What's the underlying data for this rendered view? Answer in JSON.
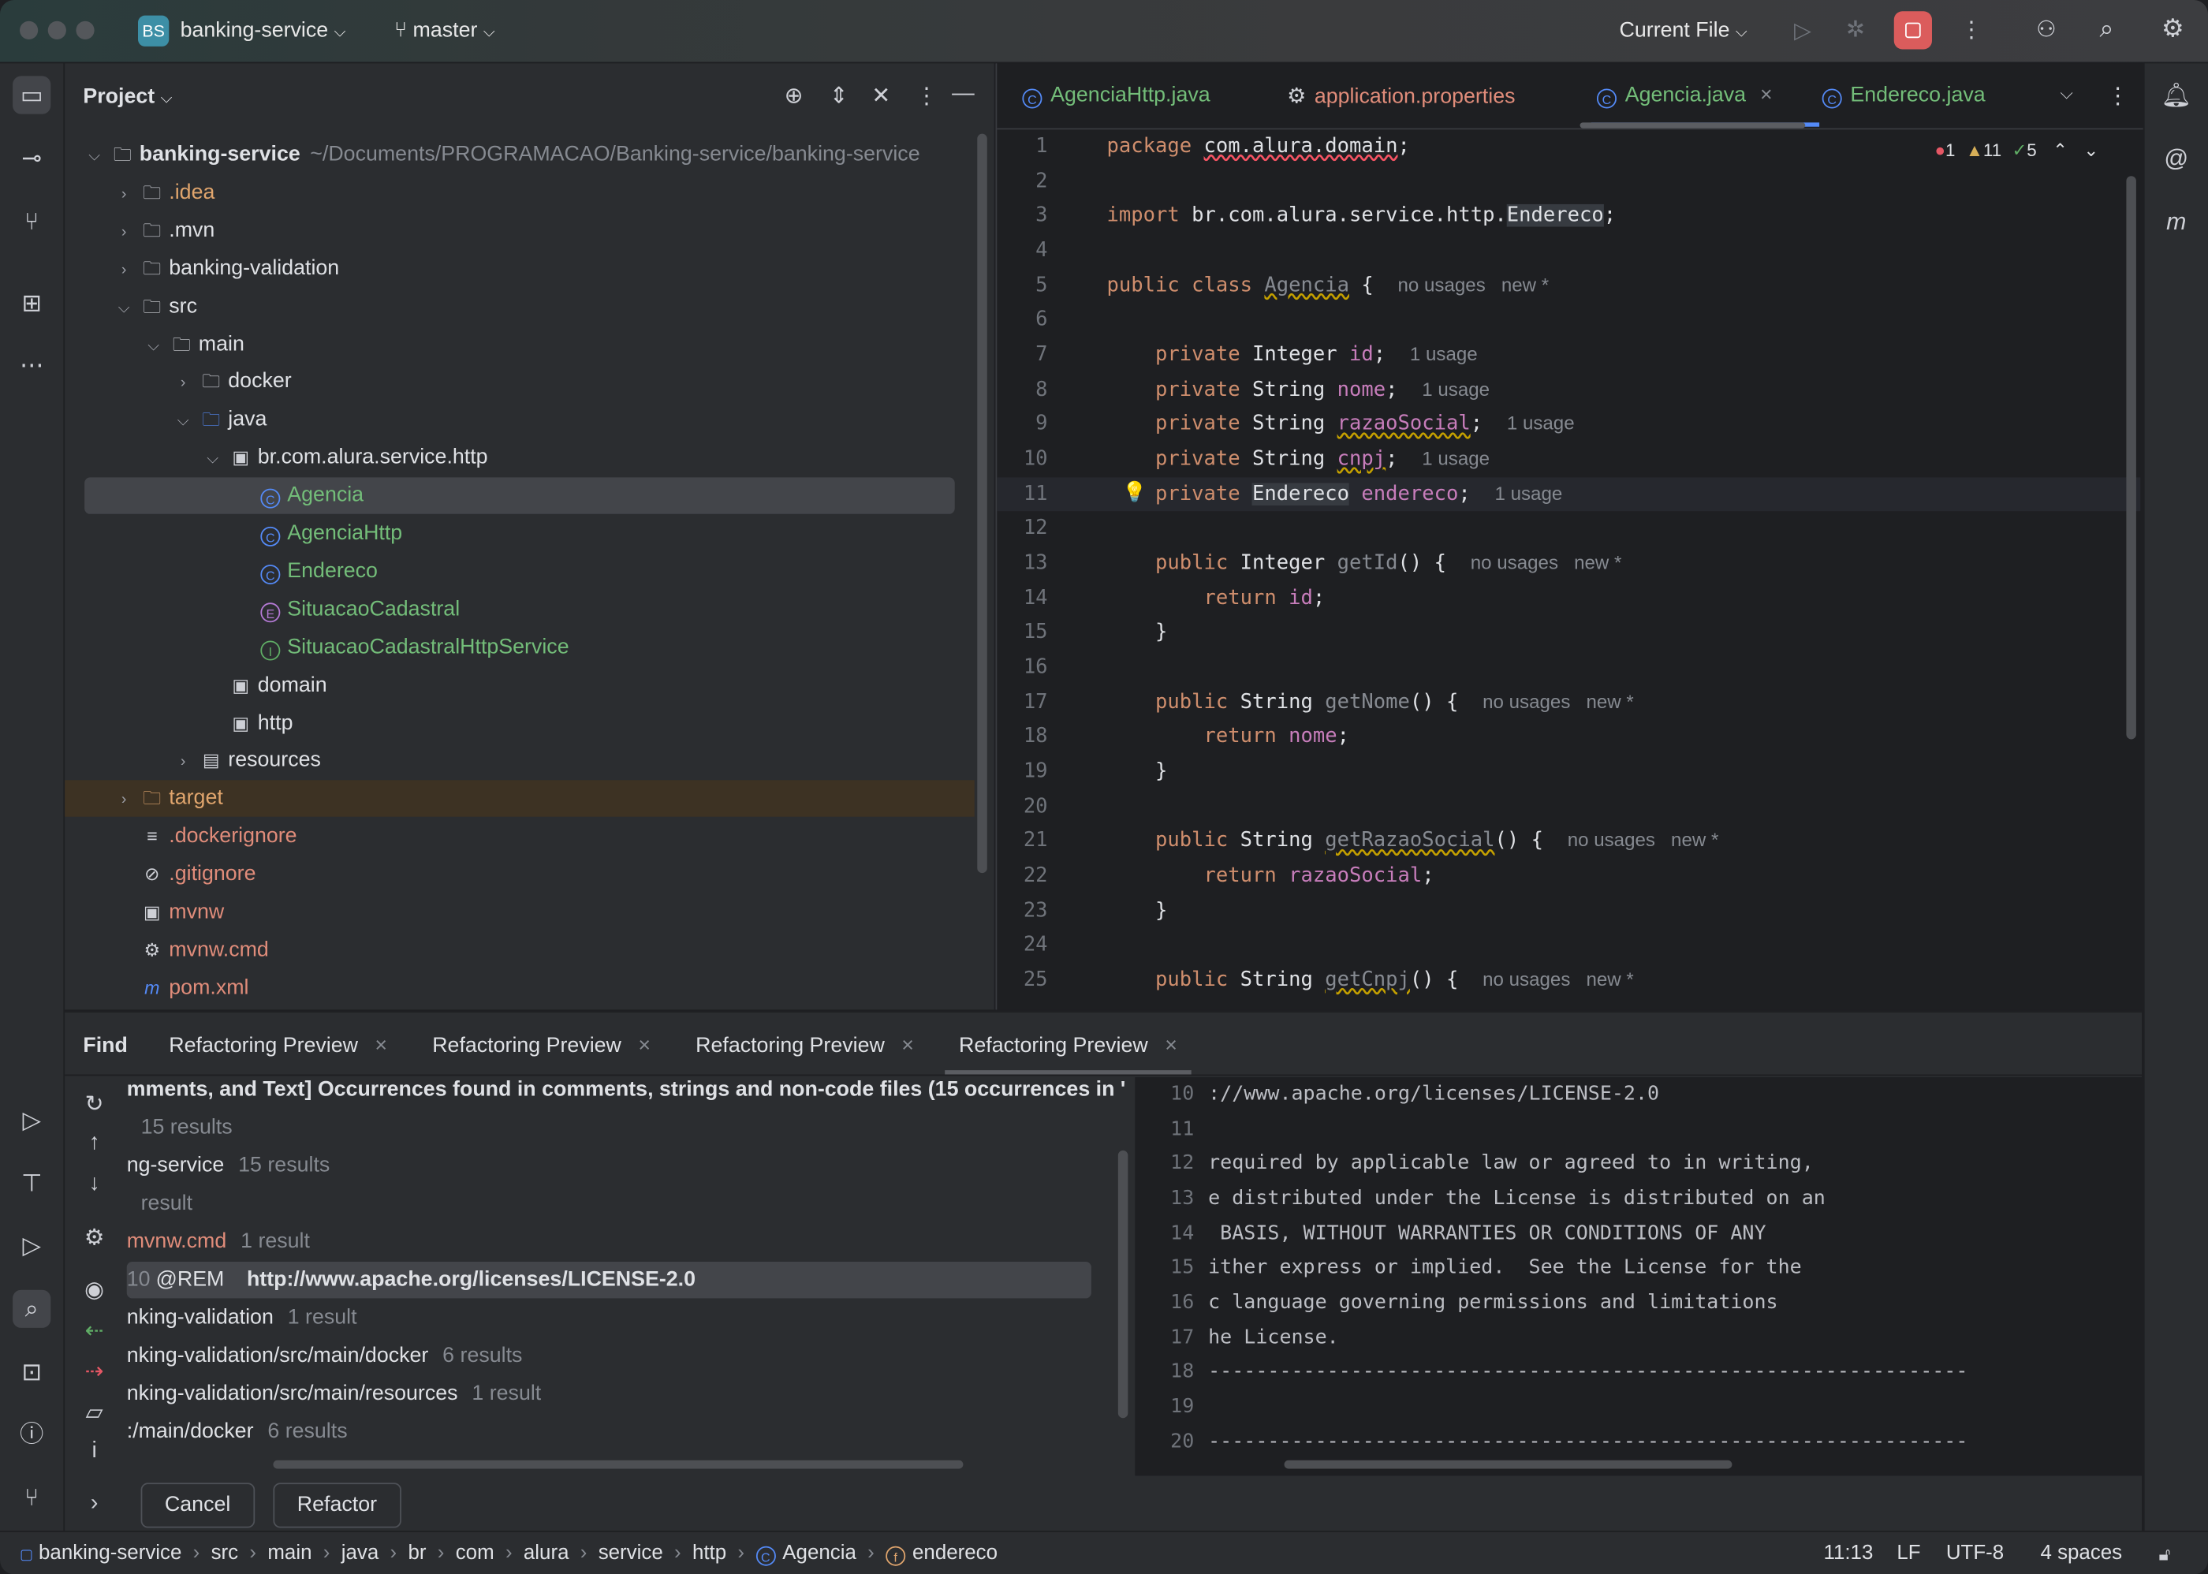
{
  "titlebar": {
    "project_badge": "BS",
    "project": "banking-service",
    "branch": "master",
    "run_config": "Current File",
    "icons": [
      "run-icon",
      "debug-icon",
      "stop-icon",
      "more-icon",
      "add-user-icon",
      "search-icon",
      "settings-icon"
    ]
  },
  "project_panel": {
    "title": "Project",
    "tree": [
      {
        "level": 0,
        "arrow": "down",
        "icon": "module",
        "label": "banking-service",
        "path": "~/Documents/PROGRAMACAO/Banking-service/banking-service",
        "bold": true
      },
      {
        "level": 1,
        "arrow": "right",
        "icon": "folder",
        "label": ".idea",
        "color": "#e0a56d"
      },
      {
        "level": 1,
        "arrow": "right",
        "icon": "folder",
        "label": ".mvn"
      },
      {
        "level": 1,
        "arrow": "right",
        "icon": "folder",
        "label": "banking-validation"
      },
      {
        "level": 1,
        "arrow": "down",
        "icon": "folder",
        "label": "src"
      },
      {
        "level": 2,
        "arrow": "down",
        "icon": "folder",
        "label": "main"
      },
      {
        "level": 3,
        "arrow": "right",
        "icon": "folder",
        "label": "docker"
      },
      {
        "level": 3,
        "arrow": "down",
        "icon": "folder-blue",
        "label": "java"
      },
      {
        "level": 4,
        "arrow": "down",
        "icon": "package",
        "label": "br.com.alura.service.http"
      },
      {
        "level": 5,
        "icon": "class",
        "label": "Agencia",
        "color": "#73bd79",
        "selected": true
      },
      {
        "level": 5,
        "icon": "class",
        "label": "AgenciaHttp",
        "color": "#73bd79"
      },
      {
        "level": 5,
        "icon": "class",
        "label": "Endereco",
        "color": "#73bd79"
      },
      {
        "level": 5,
        "icon": "enum",
        "label": "SituacaoCadastral",
        "color": "#73bd79"
      },
      {
        "level": 5,
        "icon": "interface",
        "label": "SituacaoCadastralHttpService",
        "color": "#73bd79"
      },
      {
        "level": 4,
        "icon": "package",
        "label": "domain"
      },
      {
        "level": 4,
        "icon": "package",
        "label": "http"
      },
      {
        "level": 3,
        "arrow": "right",
        "icon": "resources",
        "label": "resources"
      },
      {
        "level": 1,
        "arrow": "right",
        "icon": "folder-orange",
        "label": "target",
        "color": "#e0a56d",
        "target": true
      },
      {
        "level": 1,
        "icon": "lines",
        "label": ".dockerignore",
        "color": "#e08c7a"
      },
      {
        "level": 1,
        "icon": "ignore",
        "label": ".gitignore",
        "color": "#e08c7a"
      },
      {
        "level": 1,
        "icon": "terminal",
        "label": "mvnw",
        "color": "#e08c7a"
      },
      {
        "level": 1,
        "icon": "gear",
        "label": "mvnw.cmd",
        "color": "#e08c7a"
      },
      {
        "level": 1,
        "icon": "maven",
        "label": "pom.xml",
        "color": "#e08c7a"
      }
    ]
  },
  "editor": {
    "tabs": [
      {
        "label": "AgenciaHttp.java",
        "icon": "class",
        "color": "#73bd79"
      },
      {
        "label": "application.properties",
        "icon": "gear",
        "color": "#e08c7a"
      },
      {
        "label": "Agencia.java",
        "icon": "class",
        "color": "#73bd79",
        "active": true,
        "close": "×"
      },
      {
        "label": "Endereco.java",
        "icon": "class",
        "color": "#73bd79"
      }
    ],
    "inspections": {
      "errors": "1",
      "warnings": "11",
      "ok": "5"
    },
    "lines": [
      [
        {
          "k": "kw",
          "t": "package "
        },
        {
          "k": "err",
          "t": "com.alura.domain"
        },
        {
          "k": "",
          "t": ";"
        }
      ],
      [],
      [
        {
          "k": "kw",
          "t": "import "
        },
        {
          "k": "",
          "t": "br.com.alura.service.http."
        },
        {
          "k": "hl",
          "t": "Endereco"
        },
        {
          "k": "",
          "t": ";"
        }
      ],
      [],
      [
        {
          "k": "kw",
          "t": "public class "
        },
        {
          "k": "unused warn",
          "t": "Agencia"
        },
        {
          "k": "",
          "t": " {  "
        },
        {
          "k": "usage",
          "t": "no usages   new *"
        }
      ],
      [],
      [
        {
          "k": "kw",
          "t": "    private "
        },
        {
          "k": "",
          "t": "Integer "
        },
        {
          "k": "fld",
          "t": "id"
        },
        {
          "k": "",
          "t": ";  "
        },
        {
          "k": "usage",
          "t": "1 usage"
        }
      ],
      [
        {
          "k": "kw",
          "t": "    private "
        },
        {
          "k": "",
          "t": "String "
        },
        {
          "k": "fld",
          "t": "nome"
        },
        {
          "k": "",
          "t": ";  "
        },
        {
          "k": "usage",
          "t": "1 usage"
        }
      ],
      [
        {
          "k": "kw",
          "t": "    private "
        },
        {
          "k": "",
          "t": "String "
        },
        {
          "k": "fld warn",
          "t": "razaoSocial"
        },
        {
          "k": "",
          "t": ";  "
        },
        {
          "k": "usage",
          "t": "1 usage"
        }
      ],
      [
        {
          "k": "kw",
          "t": "    private "
        },
        {
          "k": "",
          "t": "String "
        },
        {
          "k": "fld warn",
          "t": "cnpj"
        },
        {
          "k": "",
          "t": ";  "
        },
        {
          "k": "usage",
          "t": "1 usage"
        }
      ],
      [
        {
          "k": "kw",
          "t": "    private "
        },
        {
          "k": "hl",
          "t": "Endereco"
        },
        {
          "k": "",
          "t": " "
        },
        {
          "k": "fld",
          "t": "endereco"
        },
        {
          "k": "",
          "t": ";  "
        },
        {
          "k": "usage",
          "t": "1 usage"
        }
      ],
      [],
      [
        {
          "k": "kw",
          "t": "    public "
        },
        {
          "k": "",
          "t": "Integer "
        },
        {
          "k": "unused",
          "t": "getId"
        },
        {
          "k": "",
          "t": "() {  "
        },
        {
          "k": "usage",
          "t": "no usages   new *"
        }
      ],
      [
        {
          "k": "kw",
          "t": "        return "
        },
        {
          "k": "fld",
          "t": "id"
        },
        {
          "k": "",
          "t": ";"
        }
      ],
      [
        {
          "k": "",
          "t": "    }"
        }
      ],
      [],
      [
        {
          "k": "kw",
          "t": "    public "
        },
        {
          "k": "",
          "t": "String "
        },
        {
          "k": "unused",
          "t": "getNome"
        },
        {
          "k": "",
          "t": "() {  "
        },
        {
          "k": "usage",
          "t": "no usages   new *"
        }
      ],
      [
        {
          "k": "kw",
          "t": "        return "
        },
        {
          "k": "fld",
          "t": "nome"
        },
        {
          "k": "",
          "t": ";"
        }
      ],
      [
        {
          "k": "",
          "t": "    }"
        }
      ],
      [],
      [
        {
          "k": "kw",
          "t": "    public "
        },
        {
          "k": "",
          "t": "String "
        },
        {
          "k": "unused warn",
          "t": "getRazaoSocial"
        },
        {
          "k": "",
          "t": "() {  "
        },
        {
          "k": "usage",
          "t": "no usages   new *"
        }
      ],
      [
        {
          "k": "kw",
          "t": "        return "
        },
        {
          "k": "fld",
          "t": "razaoSocial"
        },
        {
          "k": "",
          "t": ";"
        }
      ],
      [
        {
          "k": "",
          "t": "    }"
        }
      ],
      [],
      [
        {
          "k": "kw",
          "t": "    public "
        },
        {
          "k": "",
          "t": "String "
        },
        {
          "k": "unused warn",
          "t": "getCnpj"
        },
        {
          "k": "",
          "t": "() {  "
        },
        {
          "k": "usage",
          "t": "no usages   new *"
        }
      ]
    ],
    "current_line": 11
  },
  "bottom": {
    "tabs": [
      {
        "label": "Find",
        "bold": true
      },
      {
        "label": "Refactoring Preview",
        "close": "×"
      },
      {
        "label": "Refactoring Preview",
        "close": "×"
      },
      {
        "label": "Refactoring Preview",
        "close": "×"
      },
      {
        "label": "Refactoring Preview",
        "close": "×",
        "active": true
      }
    ],
    "results": [
      {
        "text": "mments, and Text] Occurrences found in comments, strings and non-code files  (15 occurrences in '",
        "bold": true
      },
      {
        "text": "",
        "count": "15 results"
      },
      {
        "text": "ng-service",
        "count": "15 results"
      },
      {
        "text": "",
        "count": "result"
      },
      {
        "text": "mvnw.cmd",
        "count": "1 result",
        "color": "#e08c7a"
      },
      {
        "prefix": "10",
        "text": "@REM",
        "match": "http://www.apache.org/licenses/LICENSE-2.0",
        "selected": true
      },
      {
        "text": "nking-validation",
        "count": "1 result"
      },
      {
        "text": "nking-validation/src/main/docker",
        "count": "6 results"
      },
      {
        "text": "nking-validation/src/main/resources",
        "count": "1 result"
      },
      {
        "text": ":/main/docker",
        "count": "6 results"
      }
    ],
    "preview": [
      {
        "n": "10",
        "t": "://www.apache.org/licenses/LICENSE-2.0"
      },
      {
        "n": "11",
        "t": ""
      },
      {
        "n": "12",
        "t": "required by applicable law or agreed to in writing,"
      },
      {
        "n": "13",
        "t": "e distributed under the License is distributed on an"
      },
      {
        "n": "14",
        "t": " BASIS, WITHOUT WARRANTIES OR CONDITIONS OF ANY"
      },
      {
        "n": "15",
        "t": "ither express or implied.  See the License for the"
      },
      {
        "n": "16",
        "t": "c language governing permissions and limitations"
      },
      {
        "n": "17",
        "t": "he License."
      },
      {
        "n": "18",
        "t": "----------------------------------------------------------------"
      },
      {
        "n": "19",
        "t": ""
      },
      {
        "n": "20",
        "t": "----------------------------------------------------------------"
      }
    ],
    "cancel": "Cancel",
    "refactor": "Refactor"
  },
  "status": {
    "breadcrumbs": [
      "banking-service",
      "src",
      "main",
      "java",
      "br",
      "com",
      "alura",
      "service",
      "http",
      "Agencia",
      "endereco"
    ],
    "position": "11:13",
    "line_sep": "LF",
    "encoding": "UTF-8",
    "indent": "4 spaces"
  }
}
